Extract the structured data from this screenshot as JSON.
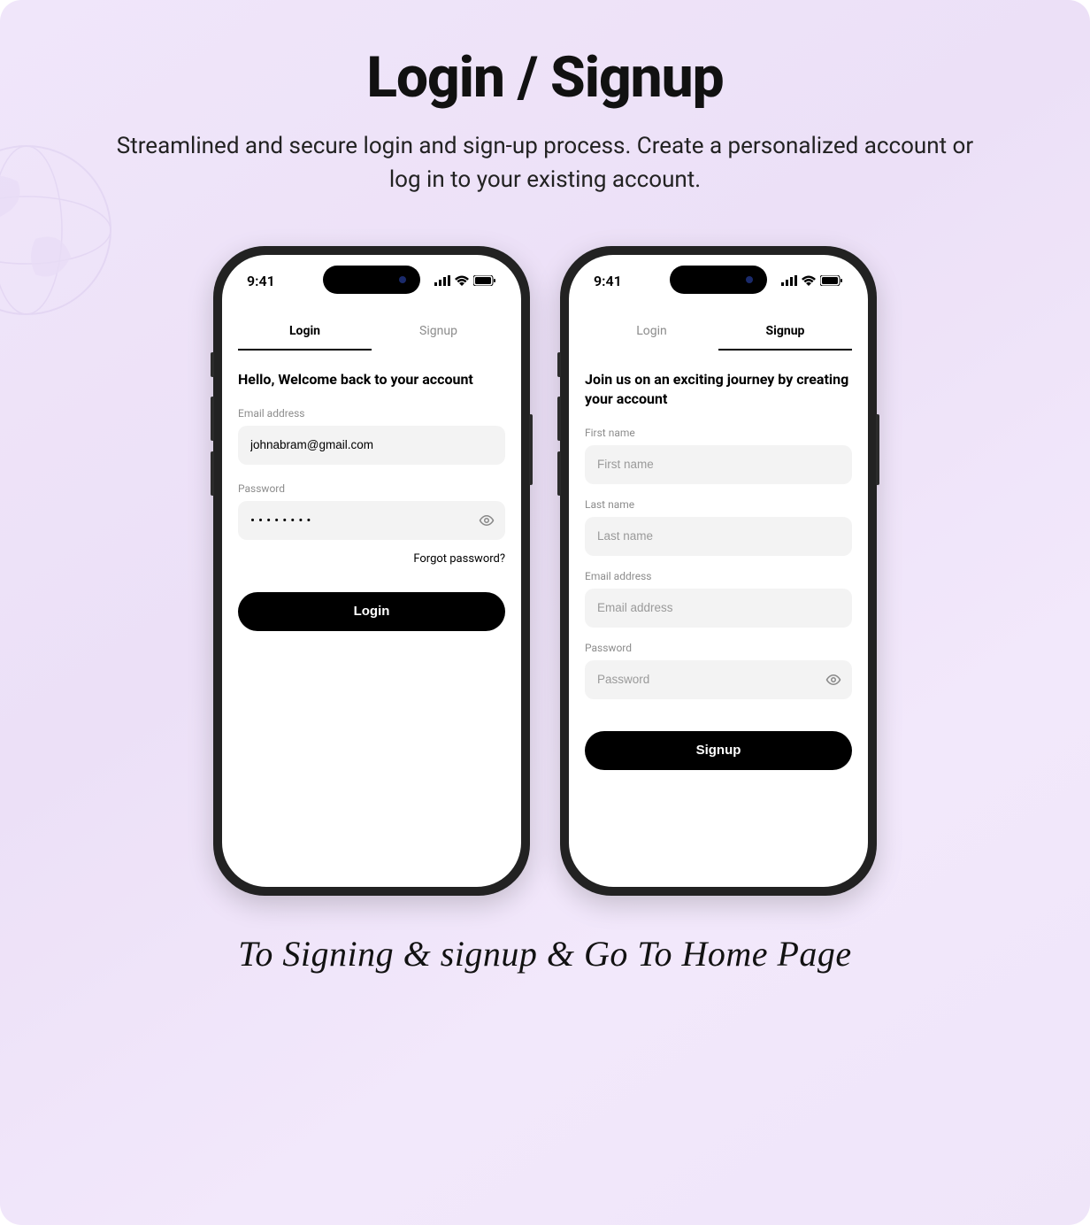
{
  "hero": {
    "title": "Login / Signup",
    "subtitle": "Streamlined and secure login and sign-up process. Create a personalized account or log in to your existing account."
  },
  "status_time": "9:41",
  "login_screen": {
    "tabs": {
      "login": "Login",
      "signup": "Signup"
    },
    "headline": "Hello, Welcome back to your account",
    "email_label": "Email address",
    "email_value": "johnabram@gmail.com",
    "password_label": "Password",
    "password_value": "••••••••",
    "forgot": "Forgot password?",
    "button": "Login"
  },
  "signup_screen": {
    "tabs": {
      "login": "Login",
      "signup": "Signup"
    },
    "headline": "Join us on an exciting journey by creating your account",
    "first_name_label": "First name",
    "first_name_placeholder": "First name",
    "last_name_label": "Last name",
    "last_name_placeholder": "Last name",
    "email_label": "Email address",
    "email_placeholder": "Email address",
    "password_label": "Password",
    "password_placeholder": "Password",
    "button": "Signup"
  },
  "caption": "To Signing & signup & Go To Home Page"
}
